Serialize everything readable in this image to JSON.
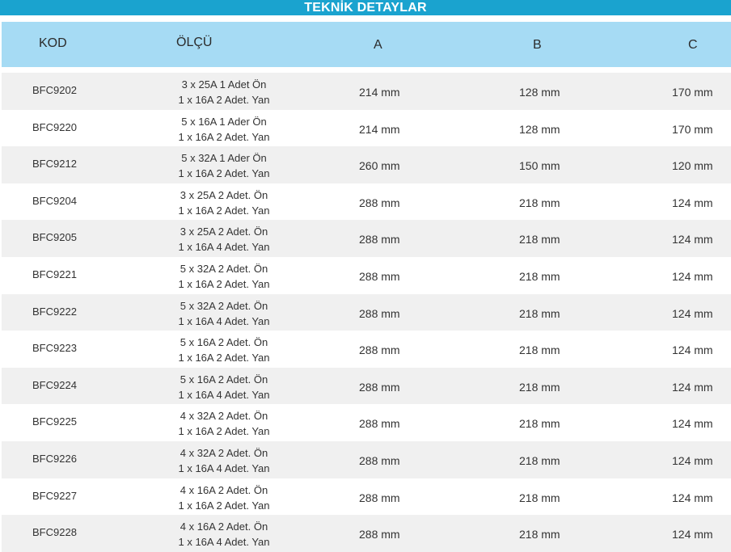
{
  "title": "TEKNİK DETAYLAR",
  "headers": {
    "kod": "KOD",
    "olcu": "ÖLÇÜ",
    "a": "A",
    "b": "B",
    "c": "C"
  },
  "rows": [
    {
      "kod": "BFC9202",
      "olcu1": "3 x 25A 1 Adet Ön",
      "olcu2": "1 x 16A 2 Adet. Yan",
      "a": "214 mm",
      "b": "128 mm",
      "c": "170 mm"
    },
    {
      "kod": "BFC9220",
      "olcu1": "5 x 16A 1 Ader Ön",
      "olcu2": "1 x 16A 2 Adet. Yan",
      "a": "214 mm",
      "b": "128 mm",
      "c": "170 mm"
    },
    {
      "kod": "BFC9212",
      "olcu1": "5 x 32A 1 Ader Ön",
      "olcu2": "1 x 16A 2 Adet. Yan",
      "a": "260 mm",
      "b": "150 mm",
      "c": "120 mm"
    },
    {
      "kod": "BFC9204",
      "olcu1": "3 x 25A 2 Adet. Ön",
      "olcu2": "1 x 16A 2 Adet. Yan",
      "a": "288 mm",
      "b": "218 mm",
      "c": "124 mm"
    },
    {
      "kod": "BFC9205",
      "olcu1": "3 x 25A 2 Adet. Ön",
      "olcu2": "1 x 16A 4 Adet. Yan",
      "a": "288 mm",
      "b": "218 mm",
      "c": "124 mm"
    },
    {
      "kod": "BFC9221",
      "olcu1": "5 x 32A 2 Adet. Ön",
      "olcu2": "1 x 16A 2 Adet. Yan",
      "a": "288 mm",
      "b": "218 mm",
      "c": "124 mm"
    },
    {
      "kod": "BFC9222",
      "olcu1": "5 x 32A 2 Adet. Ön",
      "olcu2": "1 x 16A 4 Adet. Yan",
      "a": "288 mm",
      "b": "218 mm",
      "c": "124 mm"
    },
    {
      "kod": "BFC9223",
      "olcu1": "5 x 16A 2 Adet. Ön",
      "olcu2": "1 x 16A 2 Adet. Yan",
      "a": "288 mm",
      "b": "218 mm",
      "c": "124 mm"
    },
    {
      "kod": "BFC9224",
      "olcu1": "5 x 16A 2 Adet. Ön",
      "olcu2": "1 x 16A 4 Adet. Yan",
      "a": "288 mm",
      "b": "218 mm",
      "c": "124 mm"
    },
    {
      "kod": "BFC9225",
      "olcu1": "4 x 32A 2 Adet. Ön",
      "olcu2": "1 x 16A 2 Adet. Yan",
      "a": "288 mm",
      "b": "218 mm",
      "c": "124 mm"
    },
    {
      "kod": "BFC9226",
      "olcu1": "4 x 32A 2 Adet. Ön",
      "olcu2": "1 x 16A 4 Adet. Yan",
      "a": "288 mm",
      "b": "218 mm",
      "c": "124 mm"
    },
    {
      "kod": "BFC9227",
      "olcu1": "4 x 16A 2 Adet. Ön",
      "olcu2": "1 x 16A 2 Adet. Yan",
      "a": "288 mm",
      "b": "218 mm",
      "c": "124 mm"
    },
    {
      "kod": "BFC9228",
      "olcu1": "4 x 16A 2 Adet. Ön",
      "olcu2": "1 x 16A 4 Adet. Yan",
      "a": "288 mm",
      "b": "218 mm",
      "c": "124 mm"
    }
  ]
}
